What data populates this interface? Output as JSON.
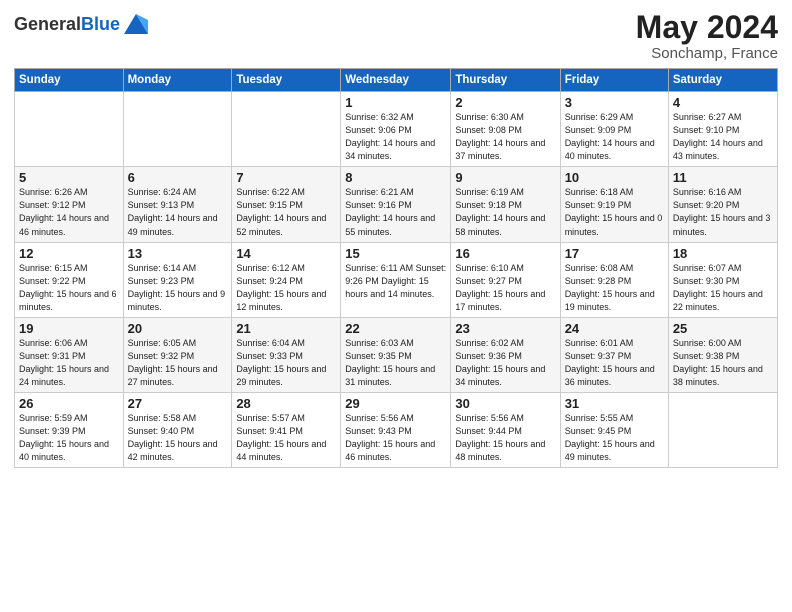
{
  "header": {
    "logo_general": "General",
    "logo_blue": "Blue",
    "title": "May 2024",
    "subtitle": "Sonchamp, France"
  },
  "days_of_week": [
    "Sunday",
    "Monday",
    "Tuesday",
    "Wednesday",
    "Thursday",
    "Friday",
    "Saturday"
  ],
  "weeks": [
    [
      {
        "day": "",
        "info": ""
      },
      {
        "day": "",
        "info": ""
      },
      {
        "day": "",
        "info": ""
      },
      {
        "day": "1",
        "info": "Sunrise: 6:32 AM\nSunset: 9:06 PM\nDaylight: 14 hours\nand 34 minutes."
      },
      {
        "day": "2",
        "info": "Sunrise: 6:30 AM\nSunset: 9:08 PM\nDaylight: 14 hours\nand 37 minutes."
      },
      {
        "day": "3",
        "info": "Sunrise: 6:29 AM\nSunset: 9:09 PM\nDaylight: 14 hours\nand 40 minutes."
      },
      {
        "day": "4",
        "info": "Sunrise: 6:27 AM\nSunset: 9:10 PM\nDaylight: 14 hours\nand 43 minutes."
      }
    ],
    [
      {
        "day": "5",
        "info": "Sunrise: 6:26 AM\nSunset: 9:12 PM\nDaylight: 14 hours\nand 46 minutes."
      },
      {
        "day": "6",
        "info": "Sunrise: 6:24 AM\nSunset: 9:13 PM\nDaylight: 14 hours\nand 49 minutes."
      },
      {
        "day": "7",
        "info": "Sunrise: 6:22 AM\nSunset: 9:15 PM\nDaylight: 14 hours\nand 52 minutes."
      },
      {
        "day": "8",
        "info": "Sunrise: 6:21 AM\nSunset: 9:16 PM\nDaylight: 14 hours\nand 55 minutes."
      },
      {
        "day": "9",
        "info": "Sunrise: 6:19 AM\nSunset: 9:18 PM\nDaylight: 14 hours\nand 58 minutes."
      },
      {
        "day": "10",
        "info": "Sunrise: 6:18 AM\nSunset: 9:19 PM\nDaylight: 15 hours\nand 0 minutes."
      },
      {
        "day": "11",
        "info": "Sunrise: 6:16 AM\nSunset: 9:20 PM\nDaylight: 15 hours\nand 3 minutes."
      }
    ],
    [
      {
        "day": "12",
        "info": "Sunrise: 6:15 AM\nSunset: 9:22 PM\nDaylight: 15 hours\nand 6 minutes."
      },
      {
        "day": "13",
        "info": "Sunrise: 6:14 AM\nSunset: 9:23 PM\nDaylight: 15 hours\nand 9 minutes."
      },
      {
        "day": "14",
        "info": "Sunrise: 6:12 AM\nSunset: 9:24 PM\nDaylight: 15 hours\nand 12 minutes."
      },
      {
        "day": "15",
        "info": "Sunrise: 6:11 AM\nSunset: 9:26 PM\nDaylight: 15 hours\nand 14 minutes."
      },
      {
        "day": "16",
        "info": "Sunrise: 6:10 AM\nSunset: 9:27 PM\nDaylight: 15 hours\nand 17 minutes."
      },
      {
        "day": "17",
        "info": "Sunrise: 6:08 AM\nSunset: 9:28 PM\nDaylight: 15 hours\nand 19 minutes."
      },
      {
        "day": "18",
        "info": "Sunrise: 6:07 AM\nSunset: 9:30 PM\nDaylight: 15 hours\nand 22 minutes."
      }
    ],
    [
      {
        "day": "19",
        "info": "Sunrise: 6:06 AM\nSunset: 9:31 PM\nDaylight: 15 hours\nand 24 minutes."
      },
      {
        "day": "20",
        "info": "Sunrise: 6:05 AM\nSunset: 9:32 PM\nDaylight: 15 hours\nand 27 minutes."
      },
      {
        "day": "21",
        "info": "Sunrise: 6:04 AM\nSunset: 9:33 PM\nDaylight: 15 hours\nand 29 minutes."
      },
      {
        "day": "22",
        "info": "Sunrise: 6:03 AM\nSunset: 9:35 PM\nDaylight: 15 hours\nand 31 minutes."
      },
      {
        "day": "23",
        "info": "Sunrise: 6:02 AM\nSunset: 9:36 PM\nDaylight: 15 hours\nand 34 minutes."
      },
      {
        "day": "24",
        "info": "Sunrise: 6:01 AM\nSunset: 9:37 PM\nDaylight: 15 hours\nand 36 minutes."
      },
      {
        "day": "25",
        "info": "Sunrise: 6:00 AM\nSunset: 9:38 PM\nDaylight: 15 hours\nand 38 minutes."
      }
    ],
    [
      {
        "day": "26",
        "info": "Sunrise: 5:59 AM\nSunset: 9:39 PM\nDaylight: 15 hours\nand 40 minutes."
      },
      {
        "day": "27",
        "info": "Sunrise: 5:58 AM\nSunset: 9:40 PM\nDaylight: 15 hours\nand 42 minutes."
      },
      {
        "day": "28",
        "info": "Sunrise: 5:57 AM\nSunset: 9:41 PM\nDaylight: 15 hours\nand 44 minutes."
      },
      {
        "day": "29",
        "info": "Sunrise: 5:56 AM\nSunset: 9:43 PM\nDaylight: 15 hours\nand 46 minutes."
      },
      {
        "day": "30",
        "info": "Sunrise: 5:56 AM\nSunset: 9:44 PM\nDaylight: 15 hours\nand 48 minutes."
      },
      {
        "day": "31",
        "info": "Sunrise: 5:55 AM\nSunset: 9:45 PM\nDaylight: 15 hours\nand 49 minutes."
      },
      {
        "day": "",
        "info": ""
      }
    ]
  ]
}
